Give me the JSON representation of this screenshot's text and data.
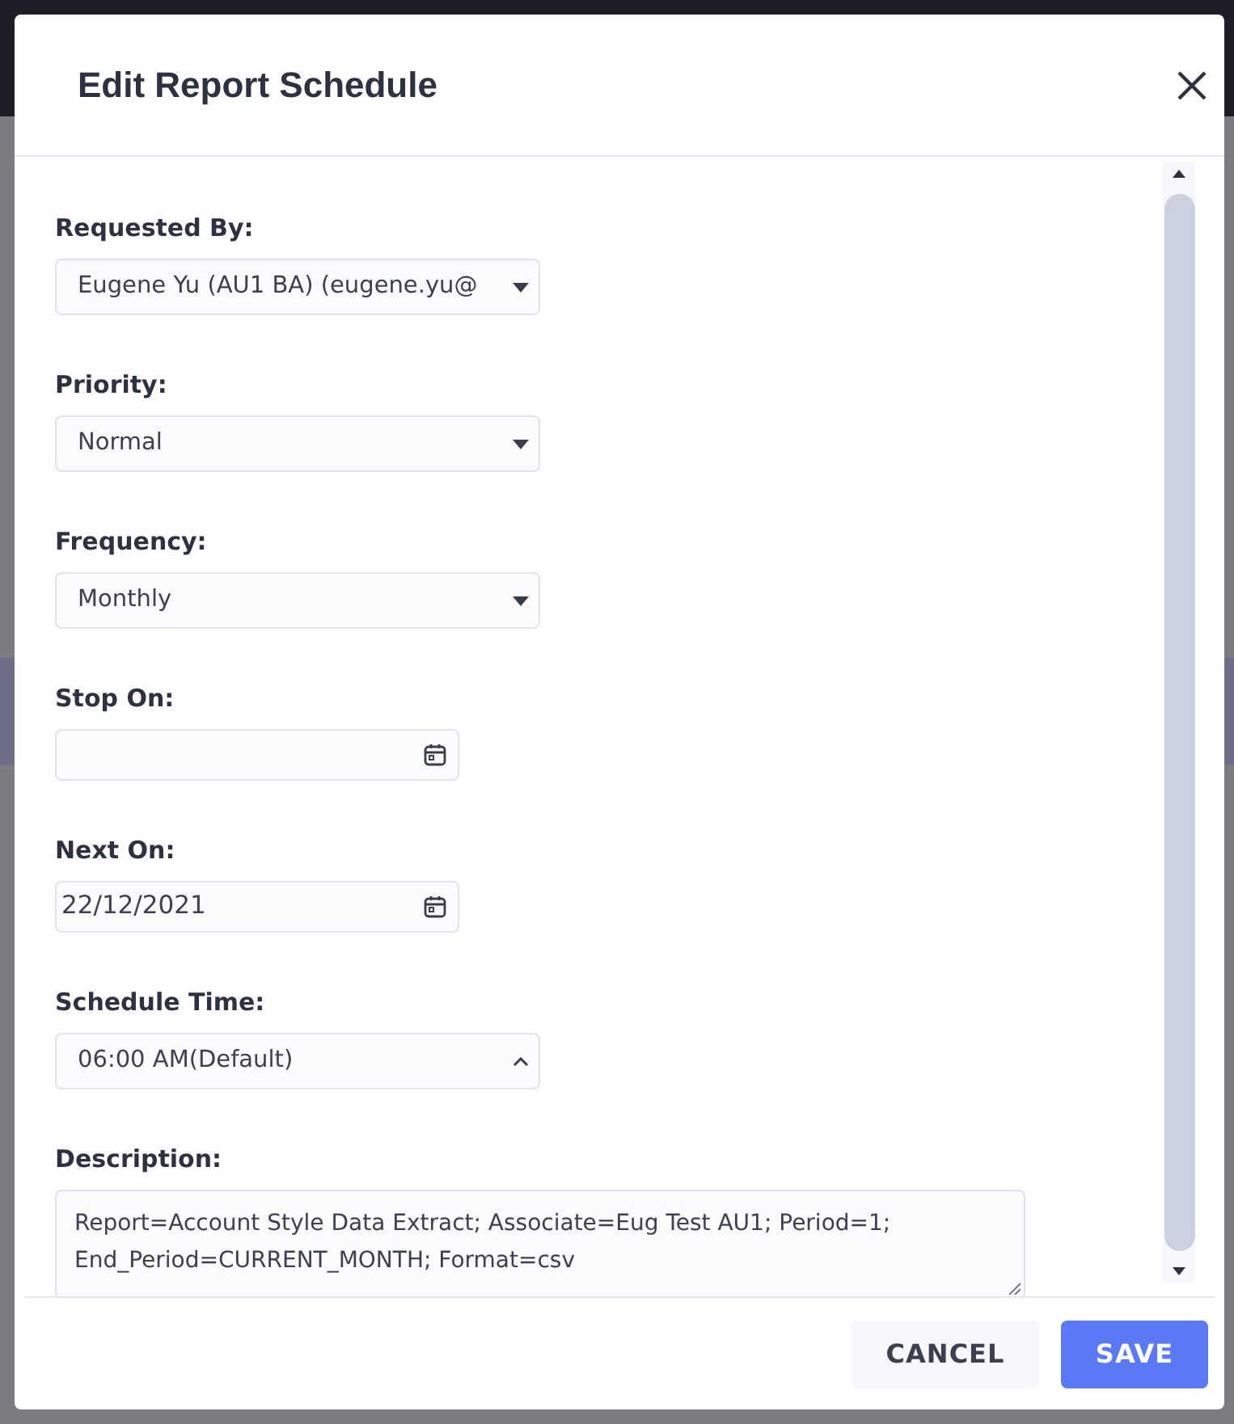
{
  "dialog": {
    "title": "Edit Report Schedule"
  },
  "fields": [
    {
      "kind": "select",
      "label": "Requested By:",
      "value": "Eugene Yu (AU1 BA) (eugene.yu@",
      "expanded": false
    },
    {
      "kind": "select",
      "label": "Priority:",
      "value": "Normal",
      "expanded": false
    },
    {
      "kind": "select",
      "label": "Frequency:",
      "value": "Monthly",
      "expanded": false
    },
    {
      "kind": "date",
      "label": "Stop On:"
    },
    {
      "kind": "date",
      "label": "Next On:",
      "value": "22/12/2021"
    },
    {
      "kind": "select",
      "label": "Schedule Time:",
      "value": "06:00 AM(Default)",
      "expanded": true
    },
    {
      "kind": "textarea",
      "label": "Description:",
      "value": "Report=Account Style Data Extract; Associate=Eug Test AU1; Period=1; End_Period=CURRENT_MONTH; Format=csv"
    }
  ],
  "buttons": [
    {
      "kind": "secondary",
      "label": "CANCEL"
    },
    {
      "kind": "primary",
      "label": "SAVE"
    }
  ]
}
